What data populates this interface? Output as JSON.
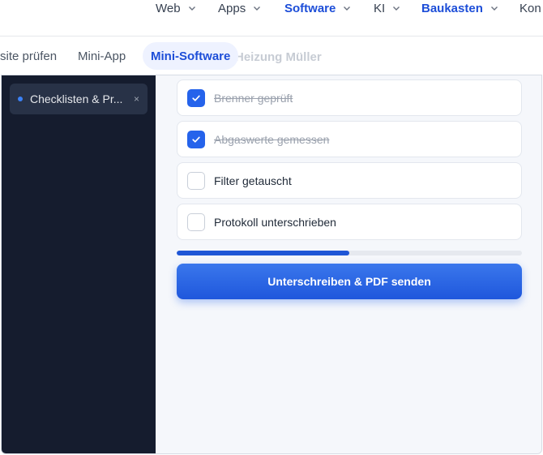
{
  "nav": {
    "items": [
      {
        "label": "Web",
        "active": false,
        "has_chevron": true
      },
      {
        "label": "Apps",
        "active": false,
        "has_chevron": true
      },
      {
        "label": "Software",
        "active": true,
        "has_chevron": true
      },
      {
        "label": "KI",
        "active": false,
        "has_chevron": true
      },
      {
        "label": "Baukasten",
        "active": true,
        "has_chevron": true
      },
      {
        "label": "Kon",
        "active": false,
        "has_chevron": false
      }
    ]
  },
  "tabs": [
    {
      "label": "site prüfen",
      "active": false
    },
    {
      "label": "Mini-App",
      "active": false
    },
    {
      "label": "Mini-Software",
      "active": true
    }
  ],
  "ghost_title": "Heizung Müller",
  "sidebar": {
    "items": [
      {
        "label": "Checklisten & Pr...",
        "close": "×"
      }
    ]
  },
  "checklist": {
    "items": [
      {
        "label": "Brenner geprüft",
        "checked": true
      },
      {
        "label": "Abgaswerte gemessen",
        "checked": true
      },
      {
        "label": "Filter getauscht",
        "checked": false
      },
      {
        "label": "Protokoll unterschrieben",
        "checked": false
      }
    ],
    "progress": 0.5
  },
  "action": {
    "label": "Unterschreiben & PDF senden"
  },
  "colors": {
    "accent": "#2563eb",
    "sidebar_bg": "#151c2e",
    "sidebar_item_bg": "#283247",
    "nav_active": "#1d4ed8"
  }
}
